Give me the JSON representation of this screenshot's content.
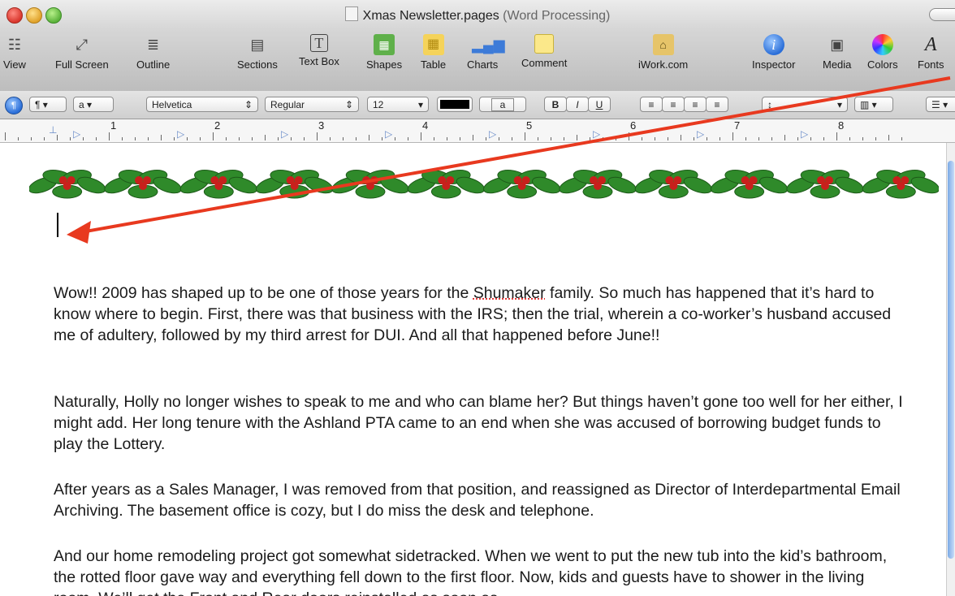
{
  "window": {
    "title": "Xmas Newsletter.pages",
    "subtitle": "(Word Processing)"
  },
  "toolbar": {
    "items": [
      {
        "label": "View",
        "icon": "view-icon"
      },
      {
        "label": "Full Screen",
        "icon": "fullscreen-icon"
      },
      {
        "label": "Outline",
        "icon": "outline-icon"
      },
      {
        "label": "Sections",
        "icon": "sections-icon"
      },
      {
        "label": "Text Box",
        "icon": "textbox-icon"
      },
      {
        "label": "Shapes",
        "icon": "shapes-icon"
      },
      {
        "label": "Table",
        "icon": "table-icon"
      },
      {
        "label": "Charts",
        "icon": "charts-icon"
      },
      {
        "label": "Comment",
        "icon": "comment-icon"
      },
      {
        "label": "iWork.com",
        "icon": "iwork-icon"
      },
      {
        "label": "Inspector",
        "icon": "inspector-icon"
      },
      {
        "label": "Media",
        "icon": "media-icon"
      },
      {
        "label": "Colors",
        "icon": "colors-icon"
      },
      {
        "label": "Fonts",
        "icon": "fonts-icon"
      }
    ]
  },
  "formatbar": {
    "paragraph_style": "¶",
    "char_style": "a",
    "font_family": "Helvetica",
    "font_typeface": "Regular",
    "font_size": "12",
    "text_color": "#000000",
    "bold": "B",
    "italic": "I",
    "underline": "U"
  },
  "ruler": {
    "numbers": [
      "1",
      "2",
      "3",
      "4",
      "5",
      "6",
      "7",
      "8"
    ]
  },
  "document": {
    "paragraphs": [
      "Wow!! 2009 has shaped up to be one of those years for the Shumaker family. So much has happened that it’s hard to know where to begin. First, there was that business with the IRS; then the trial, wherein a co-worker’s husband accused me of adultery, followed by my third arrest for DUI. And all that happened before June!!",
      "Naturally, Holly no longer wishes to speak to me and who can blame her? But things haven’t gone too well for her either, I might add. Her long tenure with the Ashland PTA came to an end when she was accused of borrowing budget funds to play the Lottery.",
      "After years as a Sales Manager, I was removed from that position, and reassigned as Director of Interdepartmental Email Archiving. The basement office is cozy, but I do miss the desk and telephone.",
      "And our home remodeling project got somewhat sidetracked. When we went to put the new tub into the kid’s bathroom, the rotted floor gave way and everything fell down to the first floor. Now, kids and guests have to shower in the living room. We’ll get the Front and Rear doors reinstalled as soon as"
    ]
  },
  "colors": {
    "arrow": "#e8391f",
    "holly_leaf": "#2f8a2a",
    "holly_berry": "#c8201c",
    "scroll_accent": "#6fa0e0"
  }
}
